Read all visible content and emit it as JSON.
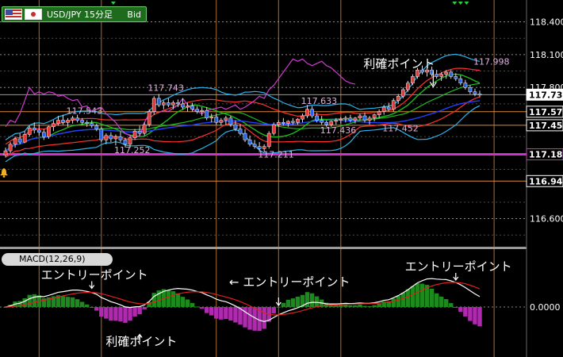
{
  "header": {
    "pair": "USD/JPY 15分足",
    "price_type": "Bid"
  },
  "panels": {
    "macd_label": "MACD(12,26,9)"
  },
  "colors": {
    "background": "#000000",
    "up_candle": "#e23b3b",
    "down_candle": "#2a63e6",
    "sma_short": "#ff3030",
    "sma_mid": "#1dbb1d",
    "sma_long": "#2040ff",
    "bollinger": "#29b4ee",
    "chikou": "#d23ad2",
    "macd_line": "#ffffff",
    "signal_line": "#e02020",
    "hist_pos": "#1c8a1c",
    "hist_neg": "#b02ab0",
    "hline_orange": "#d98a3a",
    "hline_magenta": "#d030d0",
    "current_box": "#ffffff"
  },
  "chart_data": [
    {
      "type": "candlestick",
      "symbol": "USD/JPY",
      "timeframe": "15分足",
      "ylim": [
        116.35,
        118.6
      ],
      "y_ticks": [
        118.4,
        118.1,
        117.8,
        116.6
      ],
      "price_labels": [
        {
          "value": "117.734",
          "style": "current"
        },
        {
          "value": "117.578",
          "style": "line"
        },
        {
          "value": "117.454",
          "style": "line"
        },
        {
          "value": "117.188",
          "style": "magenta"
        },
        {
          "value": "116.943",
          "style": "line"
        }
      ],
      "horizontal_lines": [
        {
          "y": 117.734,
          "color": "gray"
        },
        {
          "y": 117.578,
          "color": "orange"
        },
        {
          "y": 117.454,
          "color": "orange"
        },
        {
          "y": 117.188,
          "color": "magenta"
        },
        {
          "y": 116.943,
          "color": "orange"
        }
      ],
      "vertical_line_bars": [
        7,
        20,
        44,
        57,
        70,
        102
      ],
      "price_annotations": [
        {
          "text": "117.543",
          "bar": 16,
          "price": 117.56
        },
        {
          "text": "117.743",
          "bar": 33,
          "price": 117.77
        },
        {
          "text": "117.252",
          "bar": 26,
          "price": 117.2
        },
        {
          "text": "117.211",
          "bar": 56,
          "price": 117.16
        },
        {
          "text": "117.633",
          "bar": 65,
          "price": 117.65
        },
        {
          "text": "117.436",
          "bar": 69,
          "price": 117.38
        },
        {
          "text": "117.452",
          "bar": 82,
          "price": 117.4
        },
        {
          "text": "117.998",
          "bar": 101,
          "price": 118.01
        }
      ],
      "text_annotations": [
        {
          "text": "利確ポイント",
          "bar": 83,
          "price": 117.98,
          "arrow": "down"
        }
      ],
      "candles": [
        [
          117.18,
          117.25,
          117.16,
          117.22
        ],
        [
          117.22,
          117.3,
          117.2,
          117.28
        ],
        [
          117.28,
          117.35,
          117.25,
          117.33
        ],
        [
          117.33,
          117.38,
          117.28,
          117.3
        ],
        [
          117.3,
          117.4,
          117.29,
          117.37
        ],
        [
          117.37,
          117.45,
          117.35,
          117.43
        ],
        [
          117.43,
          117.48,
          117.38,
          117.41
        ],
        [
          117.41,
          117.46,
          117.36,
          117.39
        ],
        [
          117.39,
          117.42,
          117.32,
          117.35
        ],
        [
          117.35,
          117.45,
          117.33,
          117.44
        ],
        [
          117.44,
          117.5,
          117.4,
          117.47
        ],
        [
          117.47,
          117.54,
          117.45,
          117.5
        ],
        [
          117.5,
          117.55,
          117.46,
          117.48
        ],
        [
          117.48,
          117.52,
          117.44,
          117.5
        ],
        [
          117.5,
          117.54,
          117.47,
          117.52
        ],
        [
          117.52,
          117.55,
          117.48,
          117.5
        ],
        [
          117.5,
          117.52,
          117.46,
          117.48
        ],
        [
          117.48,
          117.5,
          117.44,
          117.47
        ],
        [
          117.47,
          117.5,
          117.43,
          117.45
        ],
        [
          117.45,
          117.47,
          117.4,
          117.42
        ],
        [
          117.42,
          117.44,
          117.3,
          117.32
        ],
        [
          117.32,
          117.38,
          117.28,
          117.36
        ],
        [
          117.36,
          117.39,
          117.3,
          117.33
        ],
        [
          117.33,
          117.37,
          117.27,
          117.35
        ],
        [
          117.35,
          117.4,
          117.3,
          117.32
        ],
        [
          117.32,
          117.34,
          117.25,
          117.28
        ],
        [
          117.28,
          117.36,
          117.25,
          117.34
        ],
        [
          117.34,
          117.42,
          117.32,
          117.4
        ],
        [
          117.4,
          117.45,
          117.36,
          117.38
        ],
        [
          117.38,
          117.48,
          117.36,
          117.46
        ],
        [
          117.46,
          117.6,
          117.44,
          117.58
        ],
        [
          117.58,
          117.72,
          117.55,
          117.7
        ],
        [
          117.7,
          117.74,
          117.62,
          117.64
        ],
        [
          117.64,
          117.68,
          117.6,
          117.66
        ],
        [
          117.66,
          117.7,
          117.62,
          117.64
        ],
        [
          117.64,
          117.68,
          117.6,
          117.66
        ],
        [
          117.66,
          117.69,
          117.62,
          117.65
        ],
        [
          117.65,
          117.7,
          117.6,
          117.62
        ],
        [
          117.62,
          117.66,
          117.58,
          117.63
        ],
        [
          117.63,
          117.66,
          117.58,
          117.6
        ],
        [
          117.6,
          117.63,
          117.56,
          117.58
        ],
        [
          117.58,
          117.62,
          117.54,
          117.59
        ],
        [
          117.59,
          117.62,
          117.5,
          117.52
        ],
        [
          117.52,
          117.56,
          117.48,
          117.53
        ],
        [
          117.53,
          117.56,
          117.46,
          117.48
        ],
        [
          117.48,
          117.52,
          117.45,
          117.5
        ],
        [
          117.5,
          117.54,
          117.46,
          117.52
        ],
        [
          117.52,
          117.54,
          117.44,
          117.46
        ],
        [
          117.46,
          117.5,
          117.4,
          117.42
        ],
        [
          117.42,
          117.46,
          117.36,
          117.38
        ],
        [
          117.38,
          117.42,
          117.3,
          117.32
        ],
        [
          117.32,
          117.36,
          117.26,
          117.28
        ],
        [
          117.28,
          117.32,
          117.24,
          117.26
        ],
        [
          117.26,
          117.3,
          117.22,
          117.24
        ],
        [
          117.24,
          117.28,
          117.21,
          117.26
        ],
        [
          117.26,
          117.4,
          117.24,
          117.38
        ],
        [
          117.38,
          117.48,
          117.36,
          117.46
        ],
        [
          117.46,
          117.5,
          117.44,
          117.48
        ],
        [
          117.48,
          117.52,
          117.45,
          117.47
        ],
        [
          117.47,
          117.5,
          117.44,
          117.49
        ],
        [
          117.49,
          117.52,
          117.46,
          117.48
        ],
        [
          117.48,
          117.52,
          117.46,
          117.51
        ],
        [
          117.51,
          117.56,
          117.48,
          117.54
        ],
        [
          117.54,
          117.64,
          117.52,
          117.6
        ],
        [
          117.6,
          117.63,
          117.52,
          117.54
        ],
        [
          117.54,
          117.57,
          117.48,
          117.5
        ],
        [
          117.5,
          117.54,
          117.46,
          117.48
        ],
        [
          117.48,
          117.5,
          117.44,
          117.46
        ],
        [
          117.46,
          117.5,
          117.44,
          117.49
        ],
        [
          117.49,
          117.52,
          117.46,
          117.5
        ],
        [
          117.5,
          117.53,
          117.47,
          117.51
        ],
        [
          117.51,
          117.54,
          117.48,
          117.52
        ],
        [
          117.52,
          117.55,
          117.48,
          117.5
        ],
        [
          117.5,
          117.53,
          117.47,
          117.52
        ],
        [
          117.52,
          117.56,
          117.5,
          117.54
        ],
        [
          117.54,
          117.57,
          117.48,
          117.5
        ],
        [
          117.5,
          117.54,
          117.46,
          117.52
        ],
        [
          117.52,
          117.56,
          117.49,
          117.55
        ],
        [
          117.55,
          117.6,
          117.52,
          117.58
        ],
        [
          117.58,
          117.64,
          117.55,
          117.62
        ],
        [
          117.62,
          117.66,
          117.58,
          117.6
        ],
        [
          117.6,
          117.7,
          117.58,
          117.68
        ],
        [
          117.68,
          117.74,
          117.65,
          117.72
        ],
        [
          117.72,
          117.8,
          117.7,
          117.78
        ],
        [
          117.78,
          117.86,
          117.76,
          117.84
        ],
        [
          117.84,
          117.92,
          117.82,
          117.9
        ],
        [
          117.9,
          117.98,
          117.88,
          117.96
        ],
        [
          117.96,
          118.0,
          117.92,
          117.94
        ],
        [
          117.94,
          117.98,
          117.9,
          117.96
        ],
        [
          117.96,
          117.99,
          117.9,
          117.92
        ],
        [
          117.92,
          117.96,
          117.88,
          117.9
        ],
        [
          117.9,
          117.94,
          117.86,
          117.92
        ],
        [
          117.92,
          117.96,
          117.88,
          117.94
        ],
        [
          117.94,
          117.96,
          117.88,
          117.9
        ],
        [
          117.9,
          117.93,
          117.86,
          117.88
        ],
        [
          117.88,
          117.91,
          117.82,
          117.84
        ],
        [
          117.84,
          117.87,
          117.78,
          117.8
        ],
        [
          117.8,
          117.82,
          117.74,
          117.76
        ],
        [
          117.76,
          117.79,
          117.72,
          117.74
        ],
        [
          117.74,
          117.77,
          117.71,
          117.73
        ]
      ],
      "macd": {
        "zero_label": "0.0000",
        "annotations": [
          {
            "text": "エントリーポイント",
            "bar": 18,
            "level": 0.085,
            "arrow": "down"
          },
          {
            "text": "利確ポイント",
            "bar": 28,
            "level": -0.075,
            "arrow": "up"
          },
          {
            "text": "← エントリーポイント",
            "bar": 50,
            "level": 0.055,
            "arrow": "none"
          },
          {
            "text": "エントリーポイント",
            "bar": 94,
            "level": 0.12,
            "arrow": "down"
          }
        ],
        "arrow_marks": [
          {
            "bar": 57,
            "level": 0.02
          }
        ]
      }
    }
  ]
}
